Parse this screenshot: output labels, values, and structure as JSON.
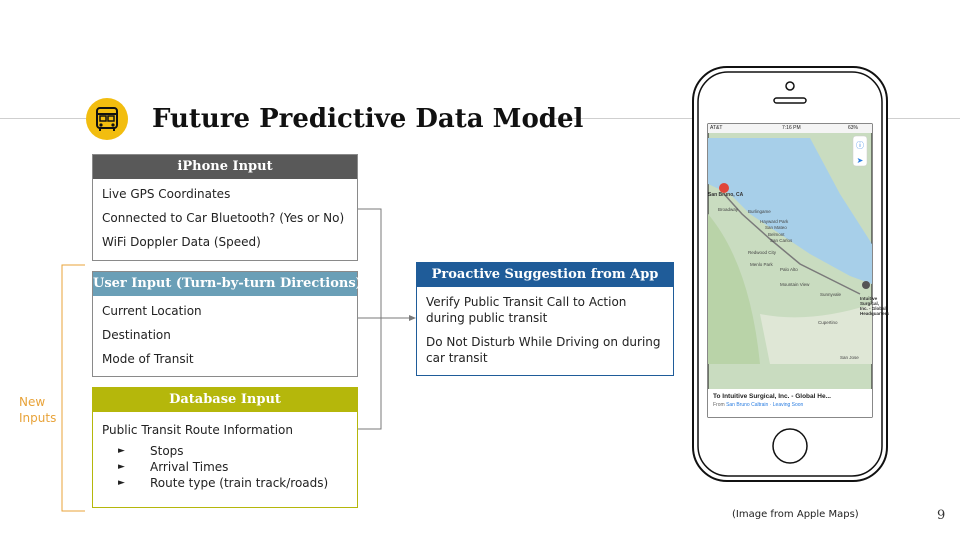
{
  "slide": {
    "title": "Future Predictive Data Model",
    "page_number": "9",
    "caption": "(Image from Apple Maps)",
    "new_inputs_note": [
      "New",
      "Inputs"
    ]
  },
  "colors": {
    "accent_yellow": "#f2bd0f",
    "iphone_header": "#595959",
    "user_header": "#6a9fb7",
    "database_header": "#b5b70b",
    "proactive_header": "#1f5c99",
    "bracket": "#e8a33a"
  },
  "boxes": {
    "iphone": {
      "header": "iPhone Input",
      "items": [
        "Live GPS Coordinates",
        "Connected to Car Bluetooth? (Yes or No)",
        "WiFi Doppler Data (Speed)"
      ]
    },
    "user": {
      "header": "User Input (Turn-by-turn Directions)",
      "items": [
        "Current Location",
        "Destination",
        "Mode of Transit"
      ]
    },
    "database": {
      "header": "Database Input",
      "intro": "Public Transit Route Information",
      "bullets": [
        "Stops",
        "Arrival Times",
        "Route type (train track/roads)"
      ]
    },
    "proactive": {
      "header": "Proactive Suggestion from App",
      "items": [
        [
          "Verify Public Transit Call to Action",
          "during public transit"
        ],
        [
          "Do Not Disturb While Driving on during",
          "car transit"
        ]
      ]
    }
  },
  "phone_map": {
    "status_bar": {
      "carrier": "AT&T",
      "time": "7:16 PM",
      "battery": "63%"
    },
    "origin_label": "San Bruno, CA",
    "destination_label": [
      "Intuitive",
      "Surgical,",
      "Inc. - Global",
      "Headquarters"
    ],
    "place_labels": [
      "Broadway",
      "Burlingame",
      "Hayward Park",
      "San Mateo",
      "Belmont",
      "San Carlos",
      "Redwood City",
      "Menlo Park",
      "Palo Alto",
      "Mountain View",
      "Sunnyvale",
      "Cupertino",
      "San Jose"
    ],
    "banner_title": "To Intuitive Surgical, Inc. - Global He...",
    "banner_from": "From",
    "banner_link": "San Bruno Caltrain · Leaving Soon"
  }
}
